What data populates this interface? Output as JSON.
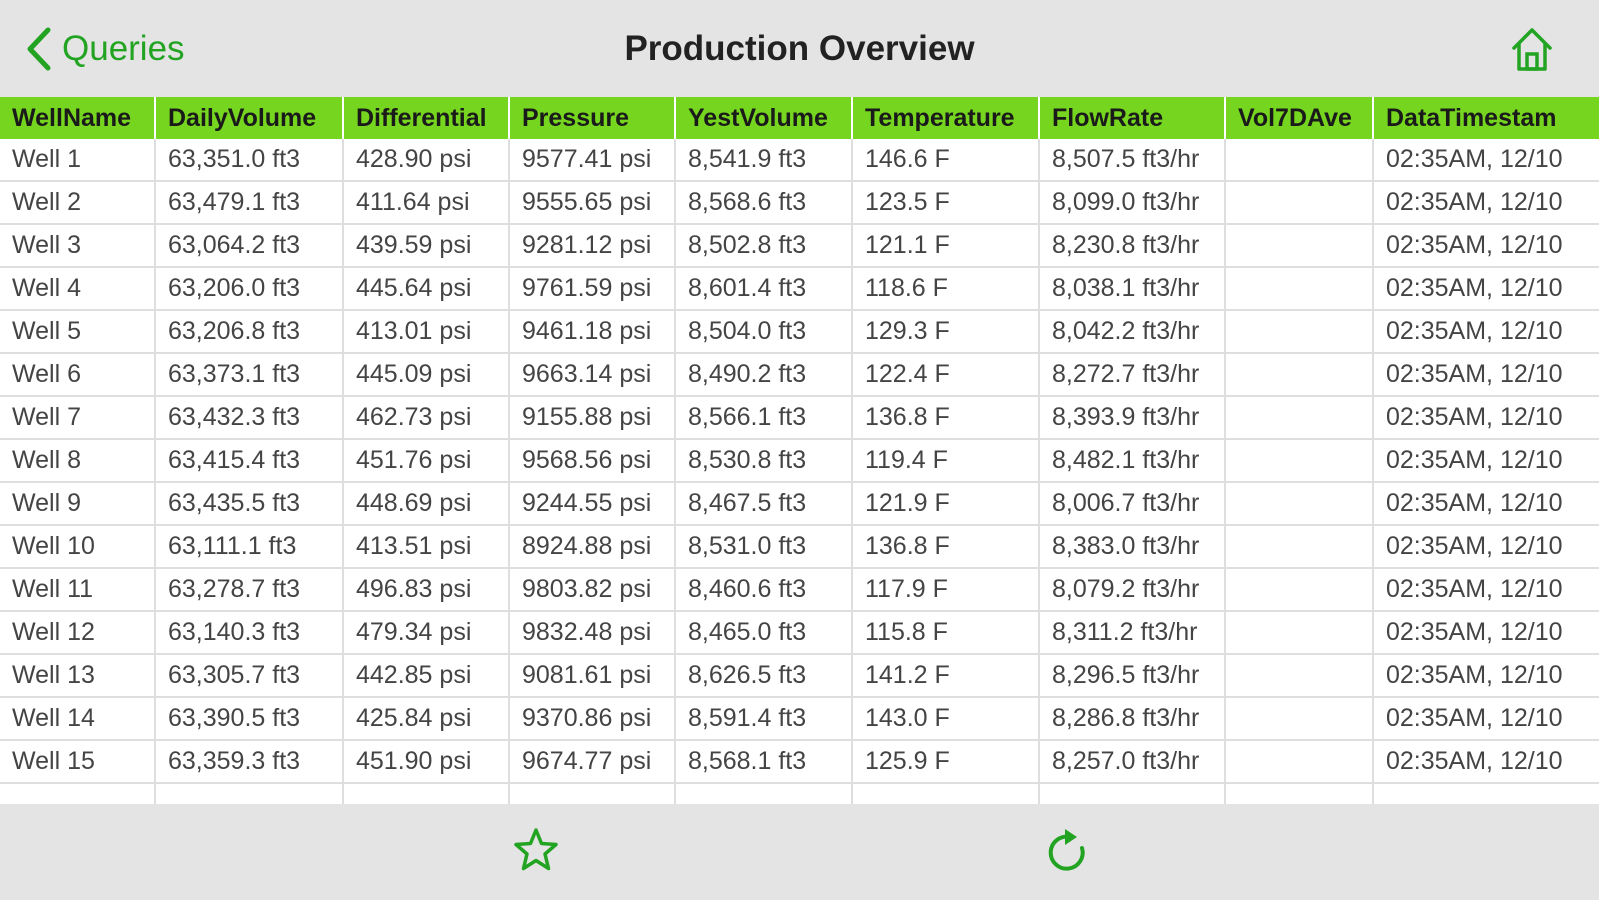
{
  "navbar": {
    "back_label": "Queries",
    "title": "Production Overview",
    "back_icon": "chevron-left-icon",
    "home_icon": "home-icon"
  },
  "table": {
    "columns": [
      "WellName",
      "DailyVolume",
      "Differential",
      "Pressure",
      "YestVolume",
      "Temperature",
      "FlowRate",
      "Vol7DAve",
      "DataTimestam"
    ],
    "rows": [
      [
        "Well 1",
        "63,351.0 ft3",
        "428.90 psi",
        "9577.41 psi",
        "8,541.9 ft3",
        "146.6 F",
        "8,507.5 ft3/hr",
        "",
        "02:35AM, 12/10"
      ],
      [
        "Well 2",
        "63,479.1 ft3",
        "411.64 psi",
        "9555.65 psi",
        "8,568.6 ft3",
        "123.5 F",
        "8,099.0 ft3/hr",
        "",
        "02:35AM, 12/10"
      ],
      [
        "Well 3",
        "63,064.2 ft3",
        "439.59 psi",
        "9281.12 psi",
        "8,502.8 ft3",
        "121.1 F",
        "8,230.8 ft3/hr",
        "",
        "02:35AM, 12/10"
      ],
      [
        "Well 4",
        "63,206.0 ft3",
        "445.64 psi",
        "9761.59 psi",
        "8,601.4 ft3",
        "118.6 F",
        "8,038.1 ft3/hr",
        "",
        "02:35AM, 12/10"
      ],
      [
        "Well 5",
        "63,206.8 ft3",
        "413.01 psi",
        "9461.18 psi",
        "8,504.0 ft3",
        "129.3 F",
        "8,042.2 ft3/hr",
        "",
        "02:35AM, 12/10"
      ],
      [
        "Well 6",
        "63,373.1 ft3",
        "445.09 psi",
        "9663.14 psi",
        "8,490.2 ft3",
        "122.4 F",
        "8,272.7 ft3/hr",
        "",
        "02:35AM, 12/10"
      ],
      [
        "Well 7",
        "63,432.3 ft3",
        "462.73 psi",
        "9155.88 psi",
        "8,566.1 ft3",
        "136.8 F",
        "8,393.9 ft3/hr",
        "",
        "02:35AM, 12/10"
      ],
      [
        "Well 8",
        "63,415.4 ft3",
        "451.76 psi",
        "9568.56 psi",
        "8,530.8 ft3",
        "119.4 F",
        "8,482.1 ft3/hr",
        "",
        "02:35AM, 12/10"
      ],
      [
        "Well 9",
        "63,435.5 ft3",
        "448.69 psi",
        "9244.55 psi",
        "8,467.5 ft3",
        "121.9 F",
        "8,006.7 ft3/hr",
        "",
        "02:35AM, 12/10"
      ],
      [
        "Well 10",
        "63,111.1 ft3",
        "413.51 psi",
        "8924.88 psi",
        "8,531.0 ft3",
        "136.8 F",
        "8,383.0 ft3/hr",
        "",
        "02:35AM, 12/10"
      ],
      [
        "Well 11",
        "63,278.7 ft3",
        "496.83 psi",
        "9803.82 psi",
        "8,460.6 ft3",
        "117.9 F",
        "8,079.2 ft3/hr",
        "",
        "02:35AM, 12/10"
      ],
      [
        "Well 12",
        "63,140.3 ft3",
        "479.34 psi",
        "9832.48 psi",
        "8,465.0 ft3",
        "115.8 F",
        "8,311.2 ft3/hr",
        "",
        "02:35AM, 12/10"
      ],
      [
        "Well 13",
        "63,305.7 ft3",
        "442.85 psi",
        "9081.61 psi",
        "8,626.5 ft3",
        "141.2 F",
        "8,296.5 ft3/hr",
        "",
        "02:35AM, 12/10"
      ],
      [
        "Well 14",
        "63,390.5 ft3",
        "425.84 psi",
        "9370.86 psi",
        "8,591.4 ft3",
        "143.0 F",
        "8,286.8 ft3/hr",
        "",
        "02:35AM, 12/10"
      ],
      [
        "Well 15",
        "63,359.3 ft3",
        "451.90 psi",
        "9674.77 psi",
        "8,568.1 ft3",
        "125.9 F",
        "8,257.0 ft3/hr",
        "",
        "02:35AM, 12/10"
      ]
    ]
  },
  "toolbar": {
    "favorite_icon": "star-icon",
    "refresh_icon": "refresh-icon"
  },
  "colors": {
    "accent": "#22a322",
    "header_green": "#76d51e",
    "bar_background": "#e4e4e4",
    "grid_line": "#dedede"
  }
}
